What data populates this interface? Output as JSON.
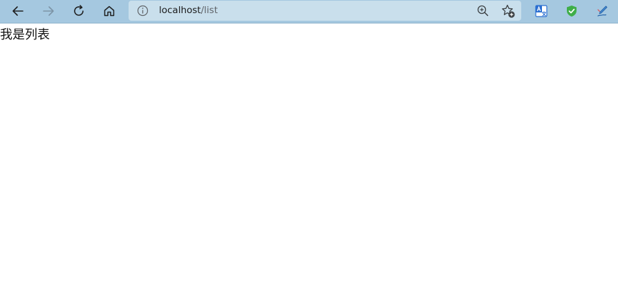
{
  "browser": {
    "address": {
      "host": "localhost",
      "path": "/list"
    },
    "icons": {
      "back": "arrow-left-icon",
      "forward": "arrow-right-icon",
      "refresh": "refresh-icon",
      "home": "home-icon",
      "info": "info-icon",
      "zoom": "zoom-in-icon",
      "favorite": "add-favorite-icon",
      "translate_ext": "translate-icon",
      "shield_ext": "shield-check-icon",
      "pen_ext": "pen-icon"
    },
    "colors": {
      "toolbar": "#a5c8e0",
      "addressbar": "#c9dfec",
      "shield": "#3fae49",
      "translate": "#2b6fd1"
    }
  },
  "page": {
    "text": "我是列表"
  }
}
